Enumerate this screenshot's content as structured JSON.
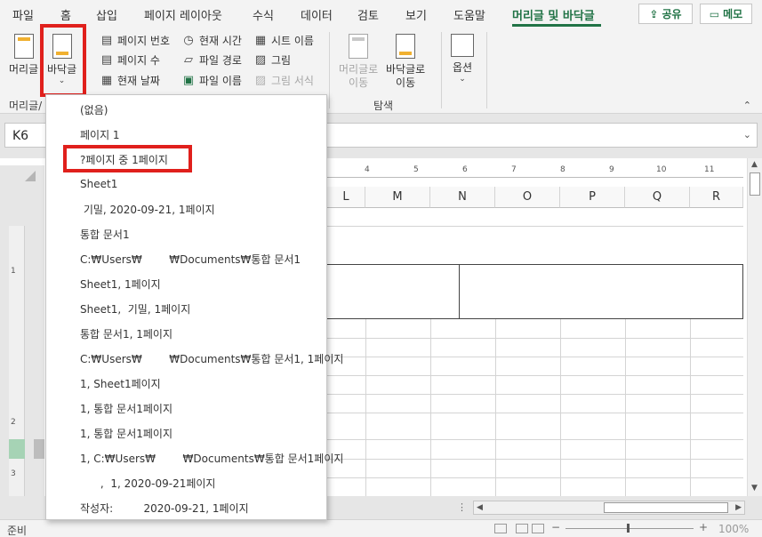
{
  "tabs": [
    "파일",
    "홈",
    "삽입",
    "페이지 레이아웃",
    "수식",
    "데이터",
    "검토",
    "보기",
    "도움말",
    "머리글 및 바닥글"
  ],
  "active_tab": "머리글 및 바닥글",
  "share_label": "공유",
  "memo_label": "메모",
  "ribbon": {
    "header_label": "머리글",
    "footer_label": "바닥글",
    "group_header_footer": "머리글/",
    "elements": {
      "page_number": "페이지 번호",
      "page_count": "페이지 수",
      "current_date": "현재 날짜",
      "current_time": "현재 시간",
      "file_path": "파일 경로",
      "file_name": "파일 이름",
      "sheet_name": "시트 이름",
      "picture": "그림",
      "format_picture": "그림 서식"
    },
    "nav": {
      "goto_header_l1": "머리글로",
      "goto_header_l2": "이동",
      "goto_footer_l1": "바닥글로",
      "goto_footer_l2": "이동",
      "group_label": "탐색"
    },
    "options_label": "옵션"
  },
  "namebox": "K6",
  "columns": [
    "L",
    "M",
    "N",
    "O",
    "P",
    "Q",
    "R"
  ],
  "ruler_h": [
    "4",
    "5",
    "6",
    "7",
    "8",
    "9",
    "10",
    "11"
  ],
  "ruler_v": [
    "1",
    "2",
    "3"
  ],
  "status_text": "준비",
  "zoom_level": "100%",
  "dropdown_items": [
    "(없음)",
    "페이지 1",
    "?페이지 중 1페이지",
    "Sheet1",
    " 기밀, 2020-09-21, 1페이지",
    "통합 문서1",
    "C:₩Users₩        ₩Documents₩통합 문서1",
    "Sheet1, 1페이지",
    "Sheet1,  기밀, 1페이지",
    "통합 문서1, 1페이지",
    "C:₩Users₩        ₩Documents₩통합 문서1, 1페이지",
    "1, Sheet1페이지",
    "1, 통합 문서1페이지",
    "1, 통합 문서1페이지",
    "1, C:₩Users₩        ₩Documents₩통합 문서1페이지",
    "      ,  1, 2020-09-21페이지",
    "작성자:         2020-09-21, 1페이지"
  ],
  "highlight_color": "#e0201c",
  "accent_color": "#217346"
}
